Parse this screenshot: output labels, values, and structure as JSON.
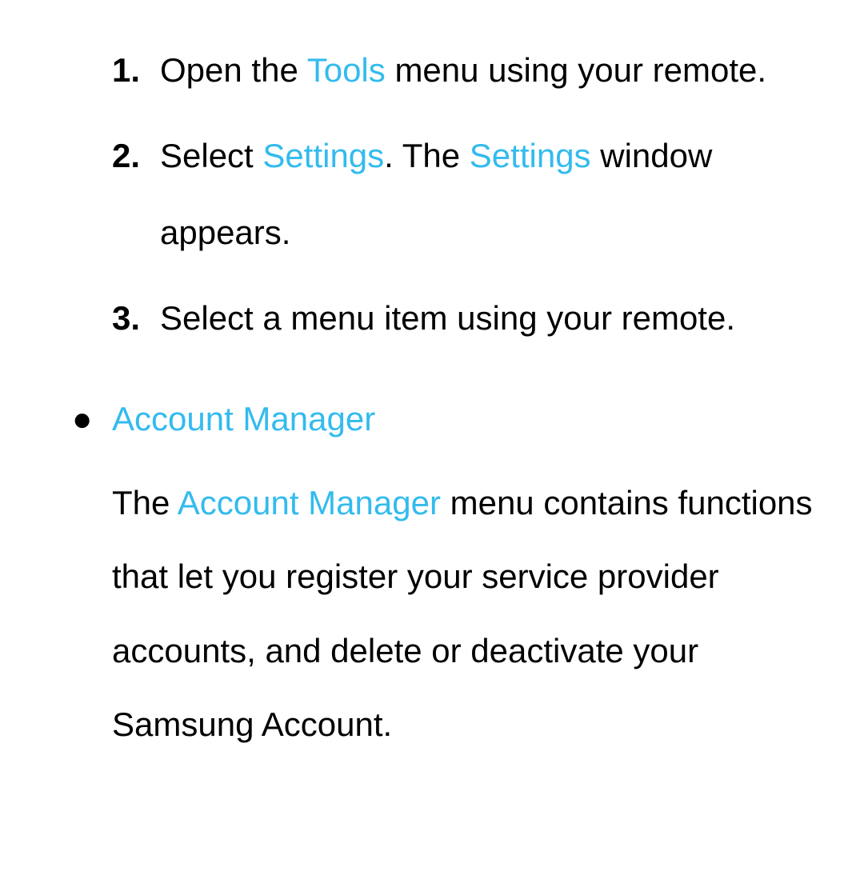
{
  "colors": {
    "highlight": "#33bbee",
    "text": "#000000"
  },
  "steps": [
    {
      "number": "1.",
      "parts": {
        "prefix": "Open the ",
        "highlight": "Tools",
        "suffix": " menu using your remote."
      }
    },
    {
      "number": "2.",
      "parts": {
        "prefix": "Select ",
        "highlight1": "Settings",
        "middle": ". The ",
        "highlight2": "Settings",
        "suffix": " window appears."
      }
    },
    {
      "number": "3.",
      "parts": {
        "text": "Select a menu item using your remote."
      }
    }
  ],
  "section": {
    "bullet": "●",
    "title": "Account Manager",
    "description": {
      "prefix": "The ",
      "highlight": "Account Manager",
      "suffix": " menu contains functions that let you register your service provider accounts, and delete or deactivate your Samsung Account."
    }
  }
}
